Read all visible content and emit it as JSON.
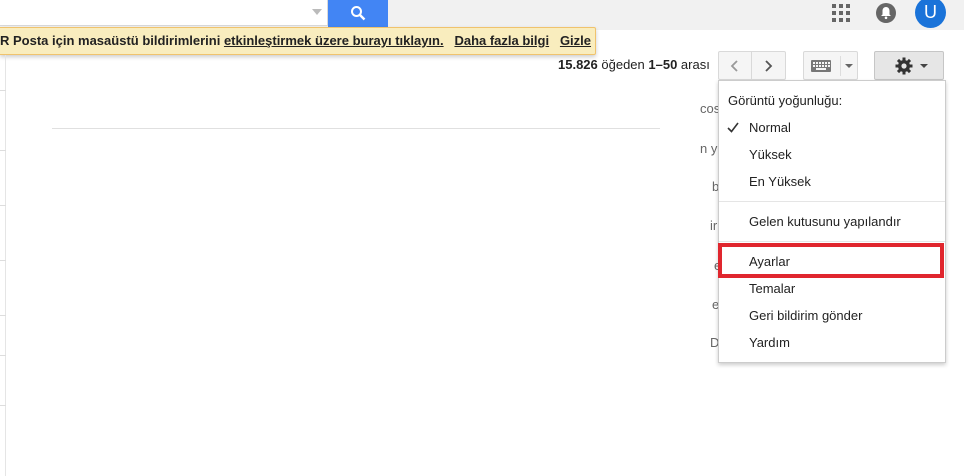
{
  "search": {
    "value": "",
    "placeholder": ""
  },
  "header": {
    "avatar_letter": "U"
  },
  "notice": {
    "lead": "R Posta için masaüstü bildirimlerini ",
    "link1": "etkinleştirmek üzere burayı tıklayın.",
    "link2": "Daha fazla bilgi",
    "link3": "Gizle"
  },
  "pagination": {
    "total": "15.826",
    "of_text": " öğeden ",
    "range": "1–50",
    "suffix": " arası"
  },
  "peek": [
    "cos",
    "n y",
    "b",
    "ir",
    "e",
    "e",
    "D"
  ],
  "settings_menu": {
    "heading": "Görüntü yoğunluğu:",
    "density": [
      {
        "label": "Normal",
        "checked": true
      },
      {
        "label": "Yüksek",
        "checked": false
      },
      {
        "label": "En Yüksek",
        "checked": false
      }
    ],
    "configure_inbox": "Gelen kutusunu yapılandır",
    "items": [
      "Ayarlar",
      "Temalar",
      "Geri bildirim gönder",
      "Yardım"
    ],
    "highlighted": "Ayarlar"
  },
  "colors": {
    "search_button": "#4285f4",
    "avatar": "#1a73d9",
    "highlight": "#e0262e",
    "notice_bg": "#f9edbe"
  },
  "icons": [
    "search-icon",
    "apps-icon",
    "notifications-icon",
    "chevron-left-icon",
    "chevron-right-icon",
    "keyboard-icon",
    "gear-icon",
    "checkmark-icon"
  ]
}
